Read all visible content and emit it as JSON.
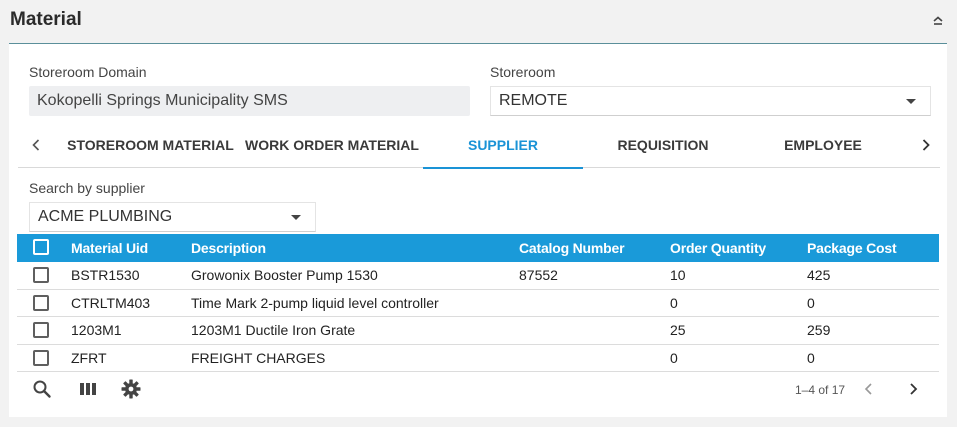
{
  "panel": {
    "title": "Material"
  },
  "form": {
    "storeroom_domain": {
      "label": "Storeroom Domain",
      "value": "Kokopelli Springs Municipality SMS"
    },
    "storeroom": {
      "label": "Storeroom",
      "value": "REMOTE"
    }
  },
  "tabs": [
    {
      "label": "STOREROOM MATERIAL",
      "active": false
    },
    {
      "label": "WORK ORDER MATERIAL",
      "active": false
    },
    {
      "label": "SUPPLIER",
      "active": true
    },
    {
      "label": "REQUISITION",
      "active": false
    },
    {
      "label": "EMPLOYEE",
      "active": false
    }
  ],
  "search": {
    "label": "Search by supplier",
    "value": "ACME PLUMBING"
  },
  "table": {
    "columns": [
      "Material Uid",
      "Description",
      "Catalog Number",
      "Order Quantity",
      "Package Cost"
    ],
    "rows": [
      [
        "BSTR1530",
        "Growonix Booster Pump 1530",
        "87552",
        "10",
        "425"
      ],
      [
        "CTRLTM403",
        "Time Mark 2-pump liquid level controller",
        "",
        "0",
        "0"
      ],
      [
        "1203M1",
        "1203M1 Ductile Iron Grate",
        "",
        "25",
        "259"
      ],
      [
        "ZFRT",
        "FREIGHT CHARGES",
        "",
        "0",
        "0"
      ]
    ]
  },
  "pagination": {
    "range": "1–4 of 17"
  },
  "colors": {
    "accent": "#1a9ad9",
    "header_rule": "#5a8f9a"
  }
}
